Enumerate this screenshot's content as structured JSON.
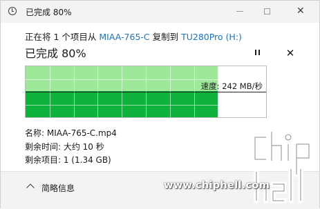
{
  "window": {
    "title": "已完成 80%",
    "controls": {
      "minimize_icon": "minimize-icon",
      "maximize_icon": "maximize-icon",
      "close_label": "✕"
    }
  },
  "transfer": {
    "prefix": "正在将 1 个项目从 ",
    "source": "MIAA-765-C",
    "middle": " 复制到 ",
    "destination": "TU280Pro (H:)",
    "percent_text": "已完成 80%",
    "progress": 0.8,
    "speed_label": "速度: 242 MB/秒"
  },
  "details": {
    "name": "名称: MIAA-765-C.mp4",
    "time_left": "剩余时间: 大约 10 秒",
    "items_left": "剩余项目: 1 (1.34 GB)"
  },
  "footer": {
    "toggle_label": "简略信息"
  },
  "watermark": {
    "site": "www.chiphell.com",
    "logo_text": "chip hell"
  },
  "colors": {
    "accent": "#1a73c9",
    "graph_dark": "#0fb33b",
    "graph_light": "#9ee89a"
  }
}
